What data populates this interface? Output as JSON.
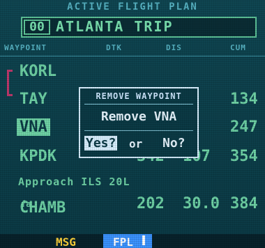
{
  "header": {
    "title": "ACTIVE FLIGHT PLAN",
    "plan_number": "00",
    "plan_name": "ATLANTA TRIP"
  },
  "columns": [
    "WAYPOINT",
    "DTK",
    "DIS",
    "CUM"
  ],
  "rows": [
    {
      "waypoint": "KORL",
      "dtk": "",
      "dis": "",
      "cum": ""
    },
    {
      "waypoint": "TAY",
      "dtk": "",
      "dis": "",
      "cum": "134"
    },
    {
      "waypoint": "VNA",
      "dtk": "",
      "dis": "",
      "cum": "247"
    },
    {
      "waypoint": "KPDK",
      "dtk": "342",
      "dis": "107",
      "cum": "354"
    }
  ],
  "approach": "Approach ILS 20L",
  "last_row": {
    "waypoint": "CHAMB",
    "suffix": "fa",
    "dtk": "202",
    "dis": "30.0",
    "cum": "384"
  },
  "dialog": {
    "title": "REMOVE WAYPOINT",
    "message": "Remove VNA",
    "yes": "Yes?",
    "or": "or",
    "no": "No?"
  },
  "status_bar": {
    "msg": "MSG",
    "fpl": "FPL"
  },
  "colors": {
    "background": "#0b3a45",
    "text": "#6fd3a6",
    "highlight": "#c0386c",
    "msg": "#ffd33b",
    "fpl_bg": "#3b93ff"
  }
}
